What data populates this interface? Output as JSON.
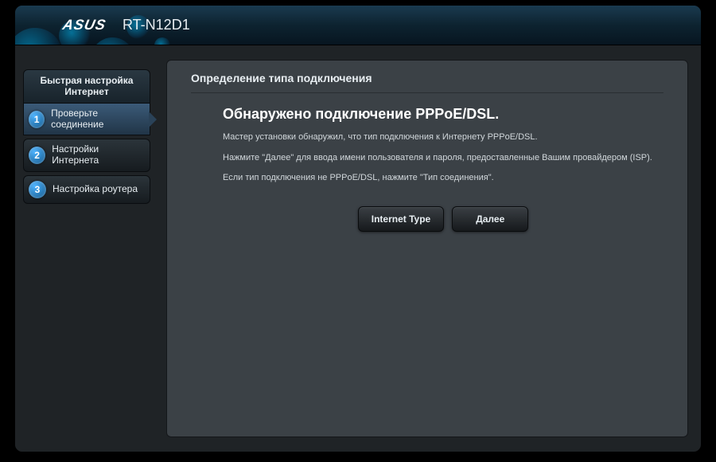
{
  "header": {
    "brand": "ASUS",
    "model": "RT-N12D1"
  },
  "sidebar": {
    "title_line1": "Быстрая настройка",
    "title_line2": "Интернет",
    "steps": [
      {
        "num": "1",
        "label": "Проверьте соединение",
        "active": true
      },
      {
        "num": "2",
        "label": "Настройки Интернета",
        "active": false
      },
      {
        "num": "3",
        "label": "Настройка роутера",
        "active": false
      }
    ]
  },
  "panel": {
    "title": "Определение типа подключения",
    "headline": "Обнаружено подключение PPPoE/DSL.",
    "line1": "Мастер установки обнаружил, что тип подключения к Интернету PPPoE/DSL.",
    "line2": "Нажмите \"Далее\" для ввода имени пользователя и пароля, предоставленные Вашим провайдером (ISP).",
    "line3": "Если тип подключения не PPPoE/DSL, нажмите \"Тип соединения\".",
    "buttons": {
      "internet_type": "Internet Type",
      "next": "Далее"
    }
  }
}
